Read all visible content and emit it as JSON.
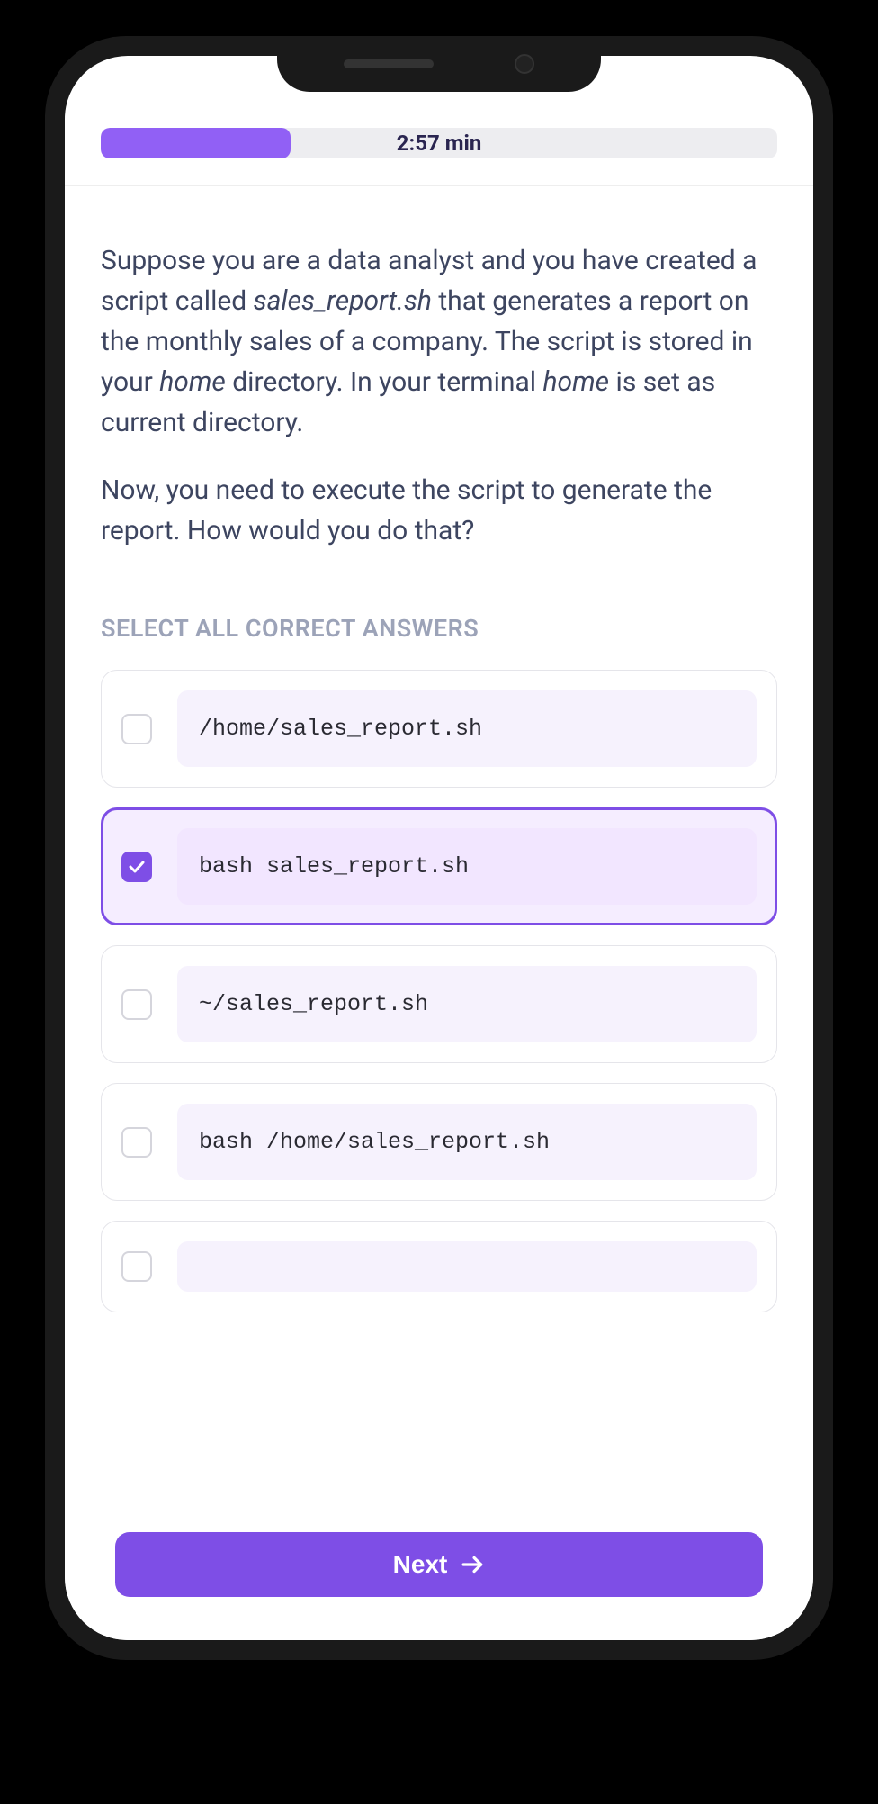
{
  "timer": "2:57 min",
  "progress_percent": 28,
  "question": {
    "paragraph1_parts": [
      {
        "t": "text",
        "v": "Suppose you are a data analyst and you have created a script called "
      },
      {
        "t": "em",
        "v": "sales_report.sh"
      },
      {
        "t": "text",
        "v": " that generates a report on the monthly sales of a company. The script is stored in your "
      },
      {
        "t": "em",
        "v": "home"
      },
      {
        "t": "text",
        "v": " directory. In your terminal "
      },
      {
        "t": "em",
        "v": "home"
      },
      {
        "t": "text",
        "v": " is set as current directory."
      }
    ],
    "paragraph2": "Now, you need to execute the script to generate the report. How would you do that?"
  },
  "instruction": "SELECT ALL CORRECT ANSWERS",
  "options": [
    {
      "code": "/home/sales_report.sh",
      "selected": false
    },
    {
      "code": "bash sales_report.sh",
      "selected": true
    },
    {
      "code": "~/sales_report.sh",
      "selected": false
    },
    {
      "code": "bash /home/sales_report.sh",
      "selected": false
    },
    {
      "code": "",
      "selected": false
    }
  ],
  "next_label": "Next"
}
